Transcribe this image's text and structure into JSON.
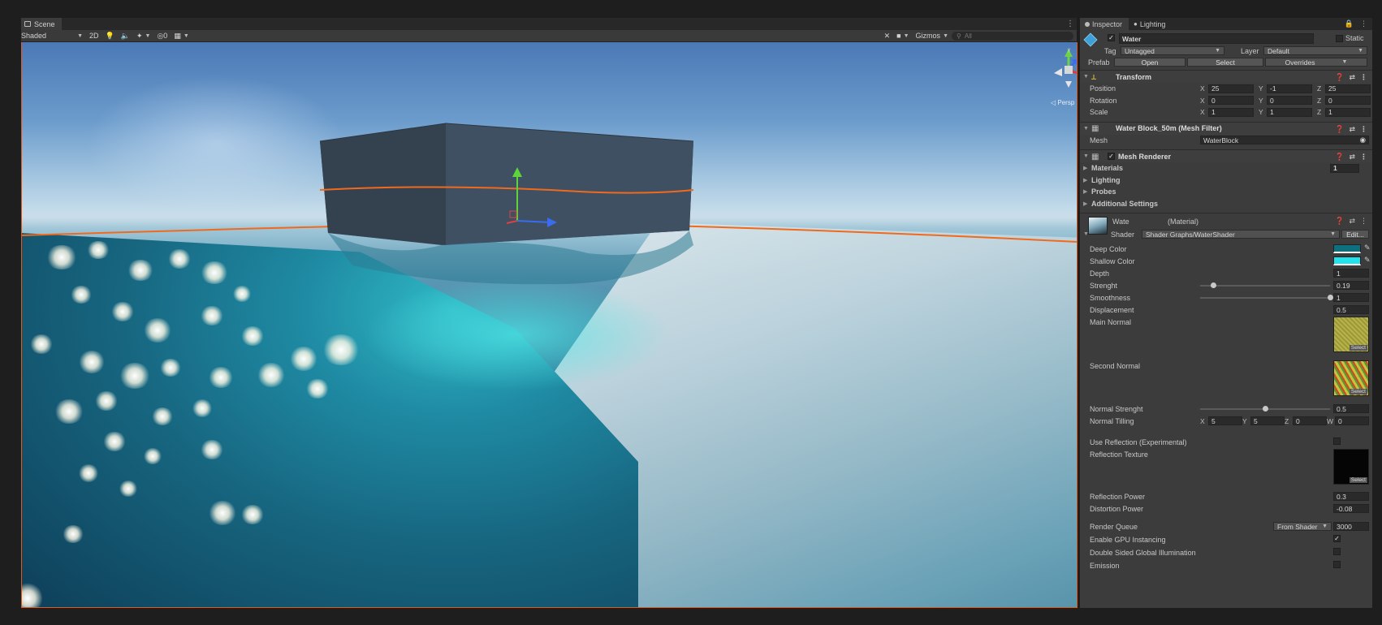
{
  "scene": {
    "tab_label": "Scene",
    "shading_mode": "Shaded",
    "mode_2d": "2D",
    "layers_count": "0",
    "gizmos_label": "Gizmos",
    "search_placeholder": "All",
    "persp_label": "Persp"
  },
  "inspector": {
    "tabs": [
      {
        "label": "Inspector"
      },
      {
        "label": "Lighting"
      }
    ],
    "object": {
      "name": "Water",
      "static_label": "Static",
      "tag_label": "Tag",
      "tag_value": "Untagged",
      "layer_label": "Layer",
      "layer_value": "Default",
      "prefab_label": "Prefab",
      "open_label": "Open",
      "select_label": "Select",
      "overrides_label": "Overrides"
    },
    "transform": {
      "title": "Transform",
      "rows": [
        {
          "label": "Position",
          "x": "25",
          "y": "-1",
          "z": "25"
        },
        {
          "label": "Rotation",
          "x": "0",
          "y": "0",
          "z": "0"
        },
        {
          "label": "Scale",
          "x": "1",
          "y": "1",
          "z": "1"
        }
      ]
    },
    "mesh_filter": {
      "title": "Water Block_50m (Mesh Filter)",
      "mesh_label": "Mesh",
      "mesh_value": "WaterBlock"
    },
    "mesh_renderer": {
      "title": "Mesh Renderer",
      "materials_label": "Materials",
      "materials_count": "1",
      "lighting_label": "Lighting",
      "probes_label": "Probes",
      "additional_label": "Additional Settings"
    },
    "material": {
      "name": "Wate",
      "type_label": "(Material)",
      "shader_label": "Shader",
      "shader_value": "Shader Graphs/WaterShader",
      "edit_label": "Edit...",
      "deep_color_label": "Deep Color",
      "deep_color": "#0e6f7e",
      "shallow_color_label": "Shallow Color",
      "shallow_color": "#22e3ec",
      "depth_label": "Depth",
      "depth_value": "1",
      "strenght_label": "Strenght",
      "strenght_value": "0.19",
      "strenght_fraction": 0.1,
      "smoothness_label": "Smoothness",
      "smoothness_value": "1",
      "smoothness_fraction": 1.0,
      "displacement_label": "Displacement",
      "displacement_value": "0.5",
      "main_normal_label": "Main Normal",
      "second_normal_label": "Second Normal",
      "select_label": "Select",
      "normal_strenght_label": "Normal Strenght",
      "normal_strenght_value": "0.5",
      "normal_strenght_fraction": 0.5,
      "normal_tiling_label": "Normal Tilling",
      "normal_tiling": {
        "x": "5",
        "y": "5",
        "z": "0",
        "w": "0"
      },
      "use_reflection_label": "Use Reflection (Experimental)",
      "reflection_texture_label": "Reflection Texture",
      "reflection_power_label": "Reflection Power",
      "reflection_power_value": "0.3",
      "distortion_power_label": "Distortion Power",
      "distortion_power_value": "-0.08",
      "render_queue_label": "Render Queue",
      "render_queue_mode": "From Shader",
      "render_queue_value": "3000",
      "gpu_instancing_label": "Enable GPU Instancing",
      "double_sided_gi_label": "Double Sided Global Illumination",
      "emission_label": "Emission"
    }
  }
}
